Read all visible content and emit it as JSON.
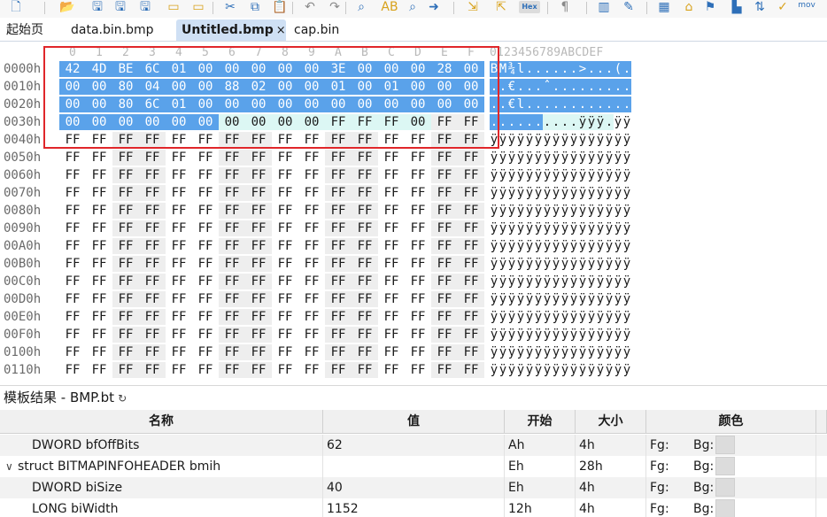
{
  "toolbar": {
    "hex_label": "Hex",
    "mov_label": "mov",
    "icons": [
      "new-file-icon",
      "open-folder-icon",
      "save-icon",
      "save-as-icon",
      "save-all-icon",
      "new-folder-icon",
      "open-icon",
      "cut-icon",
      "copy-icon",
      "paste-icon",
      "undo-icon",
      "redo-icon",
      "find-icon",
      "replace-icon",
      "find-in-files-icon",
      "goto-icon",
      "import-icon",
      "export-icon",
      "hex-mode-icon",
      "paragraph-icon",
      "columns-icon",
      "brush-icon",
      "calculator-icon",
      "home-icon",
      "bookmark-icon",
      "histogram-icon",
      "sort-icon",
      "checklist-icon"
    ]
  },
  "tabs": [
    {
      "label": "起始页",
      "active": false
    },
    {
      "label": "data.bin.bmp",
      "active": false
    },
    {
      "label": "Untitled.bmp",
      "active": true,
      "close": "×"
    },
    {
      "label": "cap.bin",
      "active": false
    }
  ],
  "hex": {
    "columns": [
      "0",
      "1",
      "2",
      "3",
      "4",
      "5",
      "6",
      "7",
      "8",
      "9",
      "A",
      "B",
      "C",
      "D",
      "E",
      "F"
    ],
    "ascii_header": "0123456789ABCDEF",
    "rows": [
      {
        "addr": "0000h",
        "bytes": [
          "42",
          "4D",
          "BE",
          "6C",
          "01",
          "00",
          "00",
          "00",
          "00",
          "00",
          "3E",
          "00",
          "00",
          "00",
          "28",
          "00"
        ],
        "ascii": "BM¾l......>...(.",
        "sel": 16,
        "hl": 0
      },
      {
        "addr": "0010h",
        "bytes": [
          "00",
          "00",
          "80",
          "04",
          "00",
          "00",
          "88",
          "02",
          "00",
          "00",
          "01",
          "00",
          "01",
          "00",
          "00",
          "00"
        ],
        "ascii": "..€...ˆ.........",
        "sel": 16,
        "hl": 0
      },
      {
        "addr": "0020h",
        "bytes": [
          "00",
          "00",
          "80",
          "6C",
          "01",
          "00",
          "00",
          "00",
          "00",
          "00",
          "00",
          "00",
          "00",
          "00",
          "00",
          "00"
        ],
        "ascii": "..€l............",
        "sel": 16,
        "hl": 0
      },
      {
        "addr": "0030h",
        "bytes": [
          "00",
          "00",
          "00",
          "00",
          "00",
          "00",
          "00",
          "00",
          "00",
          "00",
          "FF",
          "FF",
          "FF",
          "00",
          "FF",
          "FF"
        ],
        "ascii": "..........ÿÿÿ.ÿÿ",
        "sel": 6,
        "hl": 8
      },
      {
        "addr": "0040h",
        "bytes": [
          "FF",
          "FF",
          "FF",
          "FF",
          "FF",
          "FF",
          "FF",
          "FF",
          "FF",
          "FF",
          "FF",
          "FF",
          "FF",
          "FF",
          "FF",
          "FF"
        ],
        "ascii": "ÿÿÿÿÿÿÿÿÿÿÿÿÿÿÿÿ",
        "sel": 0,
        "hl": 0
      },
      {
        "addr": "0050h",
        "bytes": [
          "FF",
          "FF",
          "FF",
          "FF",
          "FF",
          "FF",
          "FF",
          "FF",
          "FF",
          "FF",
          "FF",
          "FF",
          "FF",
          "FF",
          "FF",
          "FF"
        ],
        "ascii": "ÿÿÿÿÿÿÿÿÿÿÿÿÿÿÿÿ",
        "sel": 0,
        "hl": 0
      },
      {
        "addr": "0060h",
        "bytes": [
          "FF",
          "FF",
          "FF",
          "FF",
          "FF",
          "FF",
          "FF",
          "FF",
          "FF",
          "FF",
          "FF",
          "FF",
          "FF",
          "FF",
          "FF",
          "FF"
        ],
        "ascii": "ÿÿÿÿÿÿÿÿÿÿÿÿÿÿÿÿ",
        "sel": 0,
        "hl": 0
      },
      {
        "addr": "0070h",
        "bytes": [
          "FF",
          "FF",
          "FF",
          "FF",
          "FF",
          "FF",
          "FF",
          "FF",
          "FF",
          "FF",
          "FF",
          "FF",
          "FF",
          "FF",
          "FF",
          "FF"
        ],
        "ascii": "ÿÿÿÿÿÿÿÿÿÿÿÿÿÿÿÿ",
        "sel": 0,
        "hl": 0
      },
      {
        "addr": "0080h",
        "bytes": [
          "FF",
          "FF",
          "FF",
          "FF",
          "FF",
          "FF",
          "FF",
          "FF",
          "FF",
          "FF",
          "FF",
          "FF",
          "FF",
          "FF",
          "FF",
          "FF"
        ],
        "ascii": "ÿÿÿÿÿÿÿÿÿÿÿÿÿÿÿÿ",
        "sel": 0,
        "hl": 0
      },
      {
        "addr": "0090h",
        "bytes": [
          "FF",
          "FF",
          "FF",
          "FF",
          "FF",
          "FF",
          "FF",
          "FF",
          "FF",
          "FF",
          "FF",
          "FF",
          "FF",
          "FF",
          "FF",
          "FF"
        ],
        "ascii": "ÿÿÿÿÿÿÿÿÿÿÿÿÿÿÿÿ",
        "sel": 0,
        "hl": 0
      },
      {
        "addr": "00A0h",
        "bytes": [
          "FF",
          "FF",
          "FF",
          "FF",
          "FF",
          "FF",
          "FF",
          "FF",
          "FF",
          "FF",
          "FF",
          "FF",
          "FF",
          "FF",
          "FF",
          "FF"
        ],
        "ascii": "ÿÿÿÿÿÿÿÿÿÿÿÿÿÿÿÿ",
        "sel": 0,
        "hl": 0
      },
      {
        "addr": "00B0h",
        "bytes": [
          "FF",
          "FF",
          "FF",
          "FF",
          "FF",
          "FF",
          "FF",
          "FF",
          "FF",
          "FF",
          "FF",
          "FF",
          "FF",
          "FF",
          "FF",
          "FF"
        ],
        "ascii": "ÿÿÿÿÿÿÿÿÿÿÿÿÿÿÿÿ",
        "sel": 0,
        "hl": 0
      },
      {
        "addr": "00C0h",
        "bytes": [
          "FF",
          "FF",
          "FF",
          "FF",
          "FF",
          "FF",
          "FF",
          "FF",
          "FF",
          "FF",
          "FF",
          "FF",
          "FF",
          "FF",
          "FF",
          "FF"
        ],
        "ascii": "ÿÿÿÿÿÿÿÿÿÿÿÿÿÿÿÿ",
        "sel": 0,
        "hl": 0
      },
      {
        "addr": "00D0h",
        "bytes": [
          "FF",
          "FF",
          "FF",
          "FF",
          "FF",
          "FF",
          "FF",
          "FF",
          "FF",
          "FF",
          "FF",
          "FF",
          "FF",
          "FF",
          "FF",
          "FF"
        ],
        "ascii": "ÿÿÿÿÿÿÿÿÿÿÿÿÿÿÿÿ",
        "sel": 0,
        "hl": 0
      },
      {
        "addr": "00E0h",
        "bytes": [
          "FF",
          "FF",
          "FF",
          "FF",
          "FF",
          "FF",
          "FF",
          "FF",
          "FF",
          "FF",
          "FF",
          "FF",
          "FF",
          "FF",
          "FF",
          "FF"
        ],
        "ascii": "ÿÿÿÿÿÿÿÿÿÿÿÿÿÿÿÿ",
        "sel": 0,
        "hl": 0
      },
      {
        "addr": "00F0h",
        "bytes": [
          "FF",
          "FF",
          "FF",
          "FF",
          "FF",
          "FF",
          "FF",
          "FF",
          "FF",
          "FF",
          "FF",
          "FF",
          "FF",
          "FF",
          "FF",
          "FF"
        ],
        "ascii": "ÿÿÿÿÿÿÿÿÿÿÿÿÿÿÿÿ",
        "sel": 0,
        "hl": 0
      },
      {
        "addr": "0100h",
        "bytes": [
          "FF",
          "FF",
          "FF",
          "FF",
          "FF",
          "FF",
          "FF",
          "FF",
          "FF",
          "FF",
          "FF",
          "FF",
          "FF",
          "FF",
          "FF",
          "FF"
        ],
        "ascii": "ÿÿÿÿÿÿÿÿÿÿÿÿÿÿÿÿ",
        "sel": 0,
        "hl": 0
      },
      {
        "addr": "0110h",
        "bytes": [
          "FF",
          "FF",
          "FF",
          "FF",
          "FF",
          "FF",
          "FF",
          "FF",
          "FF",
          "FF",
          "FF",
          "FF",
          "FF",
          "FF",
          "FF",
          "FF"
        ],
        "ascii": "ÿÿÿÿÿÿÿÿÿÿÿÿÿÿÿÿ",
        "sel": 0,
        "hl": 0
      }
    ]
  },
  "template": {
    "title": "模板结果 - BMP.bt",
    "refresh_icon": "refresh-icon",
    "headers": {
      "name": "名称",
      "value": "值",
      "start": "开始",
      "size": "大小",
      "color": "颜色"
    },
    "rows": [
      {
        "name": "DWORD bfOffBits",
        "value": "62",
        "start": "Ah",
        "size": "4h",
        "fg": "Fg:",
        "bg": "Bg:",
        "level": 1,
        "toggle": ""
      },
      {
        "name": "struct BITMAPINFOHEADER bmih",
        "value": "",
        "start": "Eh",
        "size": "28h",
        "fg": "Fg:",
        "bg": "Bg:",
        "level": 0,
        "toggle": "∨"
      },
      {
        "name": "DWORD biSize",
        "value": "40",
        "start": "Eh",
        "size": "4h",
        "fg": "Fg:",
        "bg": "Bg:",
        "level": 1,
        "toggle": ""
      },
      {
        "name": "LONG biWidth",
        "value": "1152",
        "start": "12h",
        "size": "4h",
        "fg": "Fg:",
        "bg": "Bg:",
        "level": 1,
        "toggle": ""
      }
    ]
  },
  "colors": {
    "selection": "#5aa2ea",
    "highlight": "#dcf7f4",
    "annotation_box": "#e0262a",
    "active_tab": "#cfe0f4"
  }
}
